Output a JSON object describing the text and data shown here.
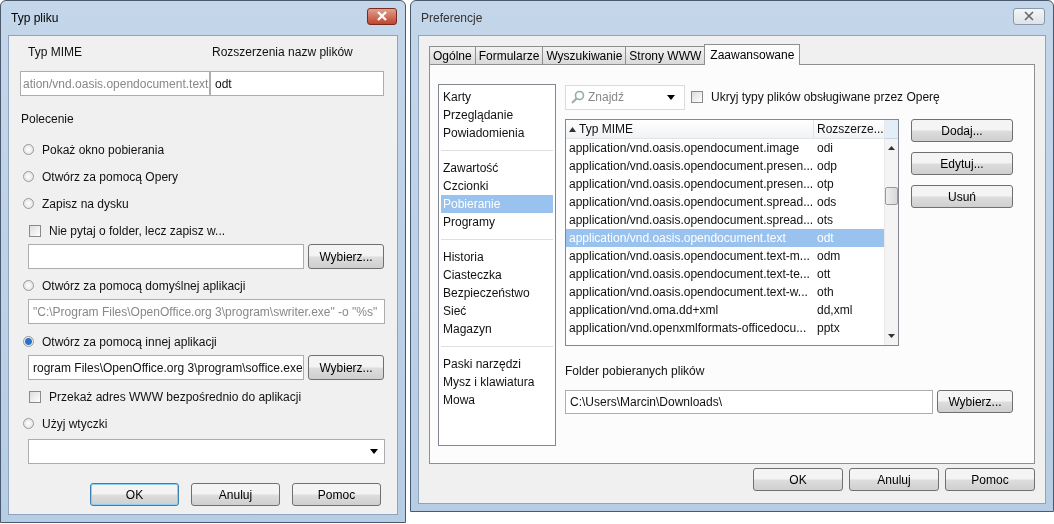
{
  "file_type_dialog": {
    "title": "Typ pliku",
    "mime_label": "Typ MIME",
    "extensions_label": "Rozszerzenia nazw plików",
    "mime_value": "ation/vnd.oasis.opendocument.text",
    "extensions_value": "odt",
    "command_label": "Polecenie",
    "options": [
      {
        "kind": "radio",
        "label": "Pokaż okno pobierania",
        "selected": false
      },
      {
        "kind": "radio",
        "label": "Otwórz za pomocą Opery",
        "selected": false
      },
      {
        "kind": "radio",
        "label": "Zapisz na dysku",
        "selected": false
      },
      {
        "kind": "checkbox",
        "label": "Nie pytaj o folder, lecz zapisz w...",
        "checked": false
      },
      {
        "kind": "path",
        "button": "Wybierz..."
      },
      {
        "kind": "radio",
        "label": "Otwórz za pomocą domyślnej aplikacji",
        "selected": false
      },
      {
        "kind": "field",
        "value": "\"C:\\Program Files\\OpenOffice.org 3\\program\\swriter.exe\" -o \"%s\"",
        "disabled": true
      },
      {
        "kind": "radio",
        "label": "Otwórz za pomocą innej aplikacji",
        "selected": true
      },
      {
        "kind": "path",
        "value": "rogram Files\\OpenOffice.org 3\\program\\soffice.exe",
        "button": "Wybierz..."
      },
      {
        "kind": "checkbox",
        "label": "Przekaż adres WWW bezpośrednio do aplikacji",
        "checked": false
      },
      {
        "kind": "radio",
        "label": "Użyj wtyczki",
        "selected": false
      },
      {
        "kind": "dropdown"
      }
    ],
    "buttons": [
      {
        "label": "OK",
        "default": true
      },
      {
        "label": "Anuluj",
        "default": false
      },
      {
        "label": "Pomoc",
        "default": false
      }
    ]
  },
  "preferences_dialog": {
    "title": "Preferencje",
    "tabs": [
      {
        "label": "Ogólne",
        "selected": false
      },
      {
        "label": "Formularze",
        "selected": false
      },
      {
        "label": "Wyszukiwanie",
        "selected": false
      },
      {
        "label": "Strony WWW",
        "selected": false
      },
      {
        "label": "Zaawansowane",
        "selected": true
      }
    ],
    "sidebar": [
      [
        {
          "label": "Karty",
          "selected": false
        },
        {
          "label": "Przeglądanie",
          "selected": false
        },
        {
          "label": "Powiadomienia",
          "selected": false
        }
      ],
      [
        {
          "label": "Zawartość",
          "selected": false
        },
        {
          "label": "Czcionki",
          "selected": false
        },
        {
          "label": "Pobieranie",
          "selected": true
        },
        {
          "label": "Programy",
          "selected": false
        }
      ],
      [
        {
          "label": "Historia",
          "selected": false
        },
        {
          "label": "Ciasteczka",
          "selected": false
        },
        {
          "label": "Bezpieczeństwo",
          "selected": false
        },
        {
          "label": "Sieć",
          "selected": false
        },
        {
          "label": "Magazyn",
          "selected": false
        }
      ],
      [
        {
          "label": "Paski narzędzi",
          "selected": false
        },
        {
          "label": "Mysz i klawiatura",
          "selected": false
        },
        {
          "label": "Mowa",
          "selected": false
        }
      ]
    ],
    "search": {
      "placeholder": "Znajdź"
    },
    "hide_checkbox": {
      "label": "Ukryj typy plików obsługiwane przez Operę",
      "checked": false
    },
    "table": {
      "columns": [
        "Typ MIME",
        "Rozszerze..."
      ],
      "rows": [
        {
          "mime": "application/vnd.oasis.opendocument.image",
          "ext": "odi",
          "selected": false
        },
        {
          "mime": "application/vnd.oasis.opendocument.presen...",
          "ext": "odp",
          "selected": false
        },
        {
          "mime": "application/vnd.oasis.opendocument.presen...",
          "ext": "otp",
          "selected": false
        },
        {
          "mime": "application/vnd.oasis.opendocument.spread...",
          "ext": "ods",
          "selected": false
        },
        {
          "mime": "application/vnd.oasis.opendocument.spread...",
          "ext": "ots",
          "selected": false
        },
        {
          "mime": "application/vnd.oasis.opendocument.text",
          "ext": "odt",
          "selected": true
        },
        {
          "mime": "application/vnd.oasis.opendocument.text-m...",
          "ext": "odm",
          "selected": false
        },
        {
          "mime": "application/vnd.oasis.opendocument.text-te...",
          "ext": "ott",
          "selected": false
        },
        {
          "mime": "application/vnd.oasis.opendocument.text-w...",
          "ext": "oth",
          "selected": false
        },
        {
          "mime": "application/vnd.oma.dd+xml",
          "ext": "dd,xml",
          "selected": false
        },
        {
          "mime": "application/vnd.openxmlformats-officedocu...",
          "ext": "pptx",
          "selected": false
        }
      ]
    },
    "side_buttons": [
      "Dodaj...",
      "Edytuj...",
      "Usuń"
    ],
    "folder_label": "Folder pobieranych plików",
    "folder_value": "C:\\Users\\Marcin\\Downloads\\",
    "folder_button": "Wybierz...",
    "buttons": [
      {
        "label": "OK",
        "default": false
      },
      {
        "label": "Anuluj",
        "default": false
      },
      {
        "label": "Pomoc",
        "default": false
      }
    ]
  }
}
